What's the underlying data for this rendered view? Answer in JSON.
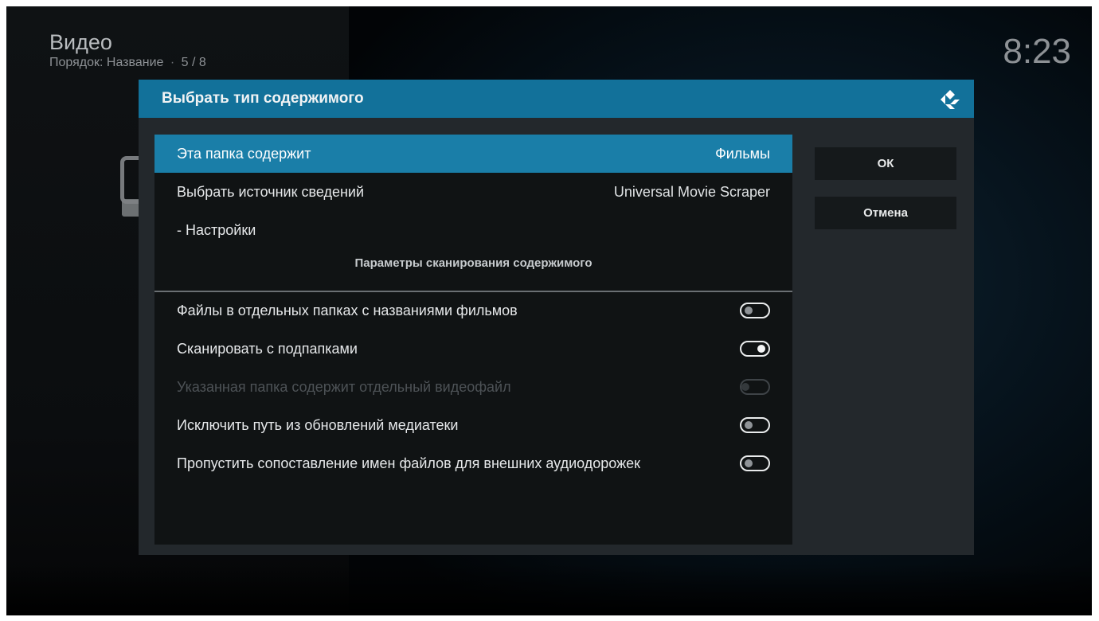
{
  "header": {
    "title": "Видео",
    "sort_label": "Порядок: Название",
    "separator": "·",
    "position": "5 / 8"
  },
  "clock": "8:23",
  "dialog": {
    "title": "Выбрать тип содержимого",
    "rows": [
      {
        "label": "Эта папка содержит",
        "value": "Фильмы"
      },
      {
        "label": "Выбрать источник сведений",
        "value": "Universal Movie Scraper"
      },
      {
        "label": "- Настройки",
        "value": ""
      }
    ],
    "section_label": "Параметры сканирования содержимого",
    "toggles": [
      {
        "label": "Файлы в отдельных папках с названиями фильмов",
        "state": "off"
      },
      {
        "label": "Сканировать с подпапками",
        "state": "on"
      },
      {
        "label": "Указанная папка содержит отдельный видеофайл",
        "state": "disabled"
      },
      {
        "label": "Исключить путь из обновлений медиатеки",
        "state": "off"
      },
      {
        "label": "Пропустить сопоставление имен файлов для внешних аудиодорожек",
        "state": "off"
      }
    ],
    "buttons": {
      "ok": "ОК",
      "cancel": "Отмена"
    }
  },
  "colors": {
    "accent": "#12719a",
    "selected_row": "#1a7ea8",
    "dialog_bg": "#23282c",
    "panel_bg": "#101314"
  },
  "icons": {
    "logo": "kodi-logo-icon"
  }
}
